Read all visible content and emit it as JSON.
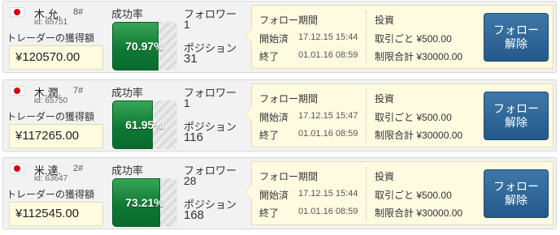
{
  "labels": {
    "success_rate": "成功率",
    "followers": "フォロワー",
    "positions": "ポジション",
    "trader_gain": "トレーダーの獲得額",
    "follow_period": "フォロー期間",
    "started": "開始済",
    "ended": "終了",
    "investment": "投資",
    "per_trade": "取引ごと",
    "limit_total": "制限合計",
    "unfollow_button": "フォロー解除"
  },
  "colors": {
    "flag_red": "#d7000f",
    "success_green": "#0f7a35",
    "button_blue": "#2f689a",
    "panel_background": "#fffbe1"
  },
  "traders": [
    {
      "flag_icon": "japan-flag-icon",
      "name": "木.允.",
      "rank": "8#",
      "id": "id: 65751",
      "gain": "¥120570.00",
      "success_rate": 70.97,
      "success_rate_text": "70.97%",
      "followers": "1",
      "positions": "31",
      "start": "17.12.15 15:44",
      "end": "01.01.16 08:59",
      "per_trade": "¥500.00",
      "limit_total": "¥30000.00"
    },
    {
      "flag_icon": "japan-flag-icon",
      "name": "木.潤.",
      "rank": "7#",
      "id": "id: 65750",
      "gain": "¥117265.00",
      "success_rate": 61.95,
      "success_rate_text": "61.95%",
      "followers": "1",
      "positions": "116",
      "start": "17.12.15 15:47",
      "end": "01.01.16 08:59",
      "per_trade": "¥500.00",
      "limit_total": "¥30000.00"
    },
    {
      "flag_icon": "japan-flag-icon",
      "name": "米.達.",
      "rank": "2#",
      "id": "id: 63647",
      "gain": "¥112545.00",
      "success_rate": 73.21,
      "success_rate_text": "73.21%",
      "followers": "28",
      "positions": "168",
      "start": "17.12.15 15:44",
      "end": "01.01.16 08:59",
      "per_trade": "¥500.00",
      "limit_total": "¥30000.00"
    }
  ]
}
